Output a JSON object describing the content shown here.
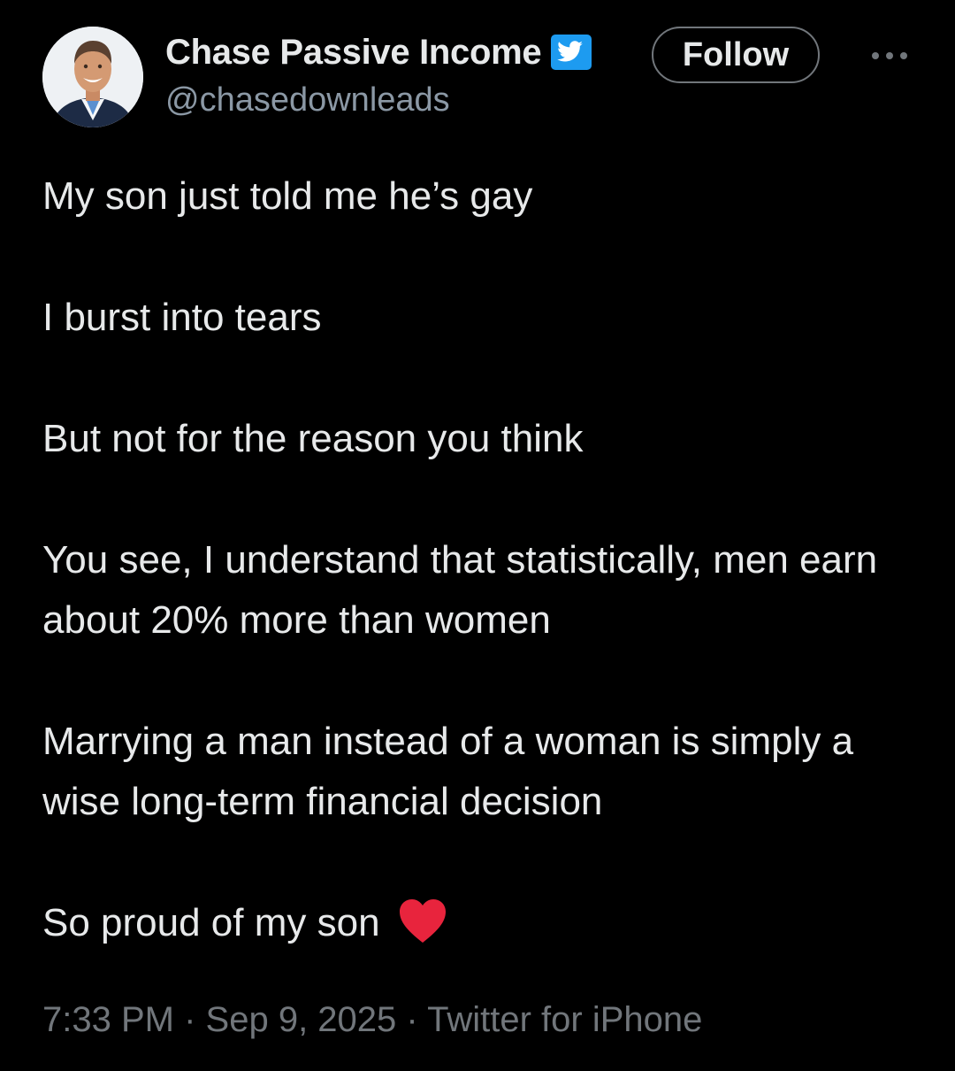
{
  "author": {
    "display_name": "Chase Passive Income",
    "handle": "@chasedownleads",
    "avatar_icon": "profile-photo",
    "verified_icon": "twitter-bird-verified-badge",
    "verified_color": "#1d9bf0"
  },
  "actions": {
    "follow_label": "Follow",
    "more_icon": "ellipsis-horizontal"
  },
  "tweet": {
    "paragraphs": [
      "My son just told me he’s gay",
      "I burst into tears",
      "But not for the reason you think",
      "You see, I understand that statistically, men earn about 20% more than women",
      "Marrying a man instead of a woman is simply a wise long-term financial decision",
      "So proud of my son"
    ],
    "emoji": "red-heart",
    "emoji_color": "#e8243d"
  },
  "meta": {
    "time": "7:33 PM",
    "date": "Sep 9, 2025",
    "source": "Twitter for iPhone",
    "separator": "·"
  },
  "colors": {
    "background": "#000000",
    "text": "#e7e9ea",
    "secondary": "#71767b"
  }
}
